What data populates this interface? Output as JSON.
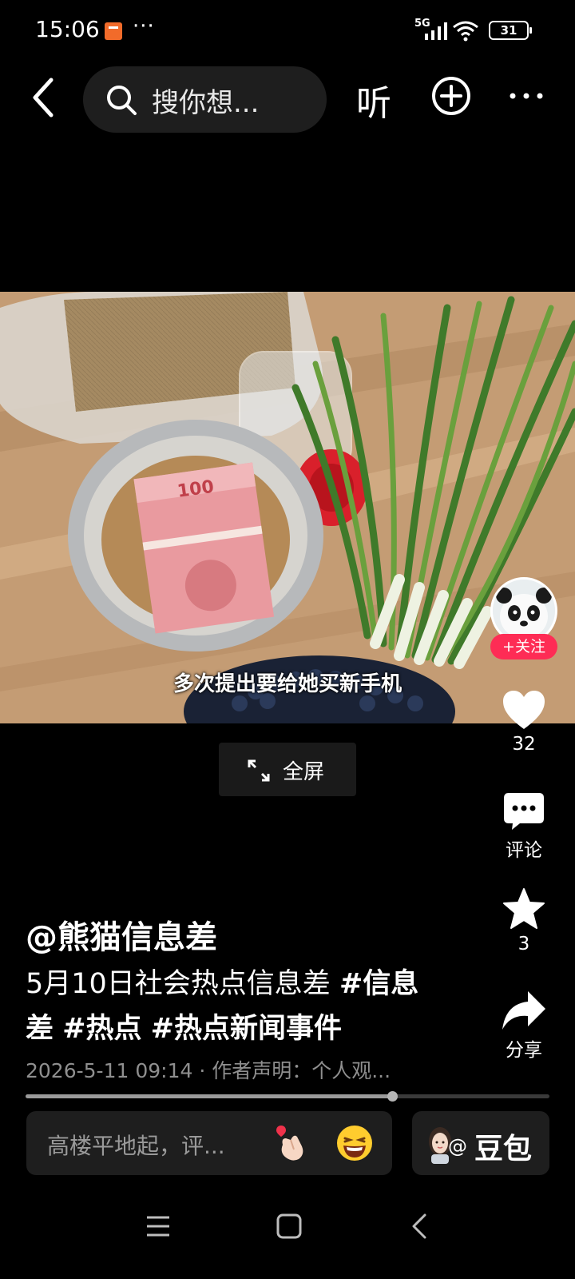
{
  "status_bar": {
    "time": "15:06",
    "dots": "···",
    "signal_label": "5G",
    "battery": "31"
  },
  "top_nav": {
    "search_placeholder": "搜你想...",
    "listen_label": "听"
  },
  "video": {
    "subtitle": "多次提出要给她买新手机"
  },
  "fullscreen": {
    "label": "全屏"
  },
  "right_rail": {
    "follow_label": "+关注",
    "likes_count": "32",
    "comment_label": "评论",
    "favorites_count": "3",
    "share_label": "分享"
  },
  "caption": {
    "author": "@熊猫信息差",
    "text": "5月10日社会热点信息差 ",
    "tags": [
      "#信息差",
      "#热点",
      "#热点新闻事件"
    ],
    "meta": "2026-5-11 09:14 · 作者声明：个人观..."
  },
  "progress": {
    "fraction": 0.7
  },
  "comment_bar": {
    "placeholder": "高楼平地起，评...",
    "doubao_at": "@",
    "doubao_label": "豆包"
  },
  "colors": {
    "background": "#000000",
    "follow_red": "#fe2c55",
    "input_bg": "#1e1e1e",
    "meta_gray": "#8f8f8f"
  },
  "icons": [
    "back-icon",
    "search-icon",
    "add-icon",
    "more-icon",
    "fullscreen-icon",
    "heart-icon",
    "comment-icon",
    "star-icon",
    "share-icon",
    "heart-hand-icon",
    "laugh-emoji-icon",
    "menu-icon",
    "home-icon",
    "back-nav-icon"
  ]
}
